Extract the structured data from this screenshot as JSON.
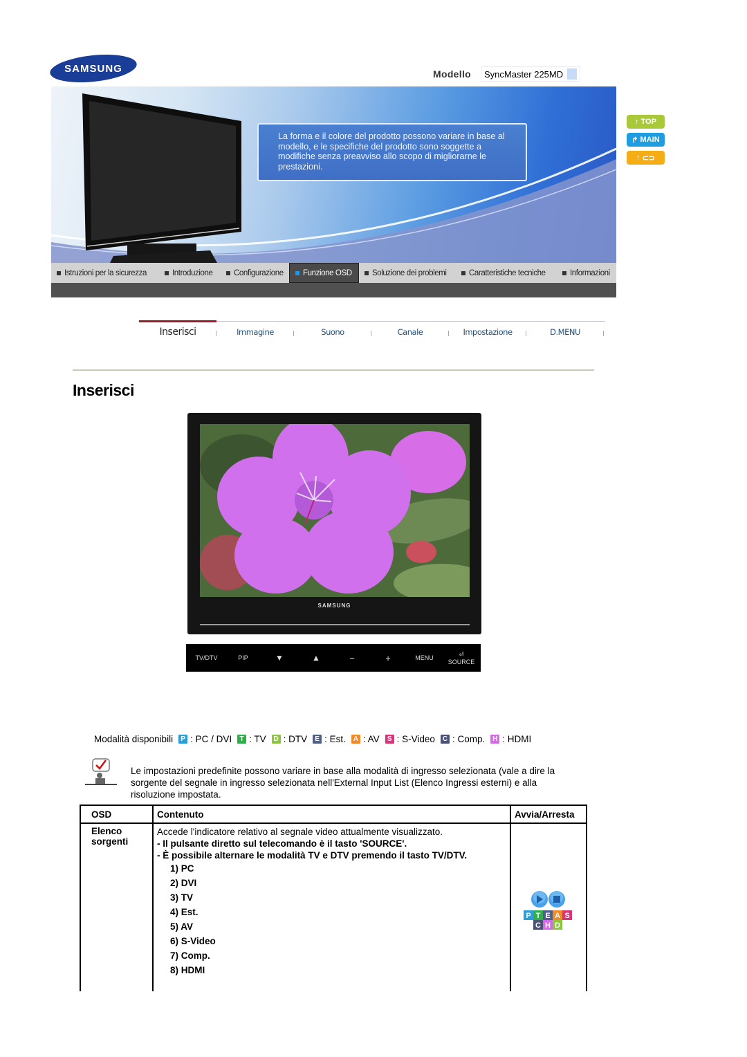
{
  "header": {
    "brand": "SAMSUNG",
    "model_label": "Modello",
    "model_value": "SyncMaster 225MD"
  },
  "banner": {
    "notice": "La forma e il colore del prodotto possono variare in base al modello, e le specifiche del prodotto sono soggette a modifiche senza preavviso allo scopo di migliorarne le prestazioni."
  },
  "side_buttons": [
    {
      "label": "TOP",
      "icon": "arrow-up-icon",
      "color": "#a9c93a"
    },
    {
      "label": "MAIN",
      "icon": "arrow-turn-up-icon",
      "color": "#1e9ee0"
    },
    {
      "label": "",
      "icon": "back-chain-icon",
      "color": "#f5ad16"
    }
  ],
  "main_nav": {
    "items": [
      {
        "label": "Istruzioni per la sicurezza",
        "active": false
      },
      {
        "label": "Introduzione",
        "active": false
      },
      {
        "label": "Configurazione",
        "active": false
      },
      {
        "label": "Funzione OSD",
        "active": true
      },
      {
        "label": "Soluzione dei problemi",
        "active": false
      },
      {
        "label": "Caratteristiche tecniche",
        "active": false
      },
      {
        "label": "Informazioni",
        "active": false
      }
    ]
  },
  "sub_nav": {
    "tabs": [
      {
        "label": "Inserisci",
        "active": true
      },
      {
        "label": "Immagine",
        "active": false
      },
      {
        "label": "Suono",
        "active": false
      },
      {
        "label": "Canale",
        "active": false
      },
      {
        "label": "Impostazione",
        "active": false
      },
      {
        "label": "D.MENU",
        "active": false
      }
    ]
  },
  "page": {
    "title": "Inserisci"
  },
  "monitor": {
    "brand": "SAMSUNG"
  },
  "button_bar": {
    "buttons": [
      {
        "label": "TV/DTV",
        "icon": ""
      },
      {
        "label": "PIP",
        "icon": ""
      },
      {
        "label": "",
        "icon": "triangle-down-icon",
        "glyph": "▼"
      },
      {
        "label": "",
        "icon": "triangle-up-icon",
        "glyph": "▲"
      },
      {
        "label": "",
        "icon": "minus-icon",
        "glyph": "−"
      },
      {
        "label": "",
        "icon": "plus-icon",
        "glyph": "+"
      },
      {
        "label": "MENU",
        "icon": ""
      },
      {
        "label": "SOURCE",
        "icon": "source-icon",
        "glyph": "⏎"
      }
    ]
  },
  "modes": {
    "label": "Modalità disponibili",
    "items": [
      {
        "letter": "P",
        "text": ": PC / DVI",
        "color": "#2a9fd8"
      },
      {
        "letter": "T",
        "text": ": TV",
        "color": "#2fae4a"
      },
      {
        "letter": "D",
        "text": ": DTV",
        "color": "#8cc63f"
      },
      {
        "letter": "E",
        "text": ": Est.",
        "color": "#4f5f88"
      },
      {
        "letter": "A",
        "text": ": AV",
        "color": "#f28a2a"
      },
      {
        "letter": "S",
        "text": ": S-Video",
        "color": "#d8357a"
      },
      {
        "letter": "C",
        "text": ": Comp.",
        "color": "#4a5278"
      },
      {
        "letter": "H",
        "text": ": HDMI",
        "color": "#d56ae8"
      }
    ]
  },
  "note": {
    "text": "Le impostazioni predefinite possono variare in base alla modalità di ingresso selezionata (vale a dire la sorgente del segnale in ingresso selezionata nell'External Input List (Elenco Ingressi esterni) e alla risoluzione impostata."
  },
  "table": {
    "headers": [
      "OSD",
      "Contenuto",
      "Avvia/Arresta"
    ],
    "rows": [
      {
        "osd": "Elenco sorgenti",
        "description": "Accede l'indicatore relativo al segnale video attualmente visualizzato.",
        "notes": [
          "- Il pulsante diretto sul telecomando è il tasto 'SOURCE'.",
          "- È possibile alternare le modalità TV e DTV premendo il tasto TV/DTV."
        ],
        "list": [
          "1) PC",
          "2) DVI",
          "3) TV",
          "4) Est.",
          "5) AV",
          "6) S-Video",
          "7) Comp.",
          "8) HDMI"
        ],
        "play_letters_top": [
          "P",
          "T",
          "E",
          "A",
          "S"
        ],
        "play_letters_bottom": [
          "C",
          "H",
          "D"
        ]
      }
    ]
  }
}
